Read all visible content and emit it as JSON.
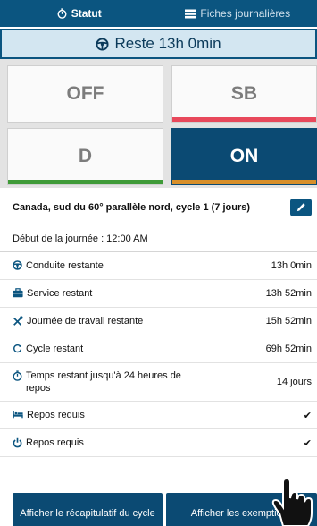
{
  "tabs": [
    {
      "label": "Statut",
      "icon": "stopwatch-icon",
      "active": true
    },
    {
      "label": "Fiches journalières",
      "icon": "list-icon",
      "active": false
    }
  ],
  "remaining": {
    "label": "Reste 13h 0min",
    "icon": "steering-wheel-icon"
  },
  "statuses": {
    "off": {
      "label": "OFF",
      "bar_color": ""
    },
    "sb": {
      "label": "SB",
      "bar_color": "#e8485b"
    },
    "d": {
      "label": "D",
      "bar_color": "#3f9b38"
    },
    "on": {
      "label": "ON",
      "bar_color": "#d88f2a",
      "active": true
    }
  },
  "cycle": {
    "text": "Canada, sud du 60° parallèle nord, cycle 1 (7 jours)",
    "edit_icon": "pencil-icon"
  },
  "day_start": "Début de la journée : 12:00 AM",
  "rows": [
    {
      "label": "Conduite restante",
      "value": "13h 0min",
      "icon": "steering-wheel-icon"
    },
    {
      "label": "Service restant",
      "value": "13h 52min",
      "icon": "briefcase-icon"
    },
    {
      "label": "Journée de travail restante",
      "value": "15h 52min",
      "icon": "tools-icon"
    },
    {
      "label": "Cycle restant",
      "value": "69h 52min",
      "icon": "refresh-icon"
    },
    {
      "label": "Temps restant jusqu'à 24 heures de repos",
      "value": "14 jours",
      "icon": "stopwatch-icon"
    },
    {
      "label": "Repos requis",
      "value": "✔",
      "icon": "bed-icon"
    },
    {
      "label": "Repos requis",
      "value": "✔",
      "icon": "power-icon"
    }
  ],
  "buttons": {
    "recap": "Afficher le récapitulatif du cycle",
    "exemptions": "Afficher les exemptions"
  },
  "colors": {
    "primary": "#0b5580",
    "highlight": "#d3e6f1",
    "check": "#4caf50"
  }
}
